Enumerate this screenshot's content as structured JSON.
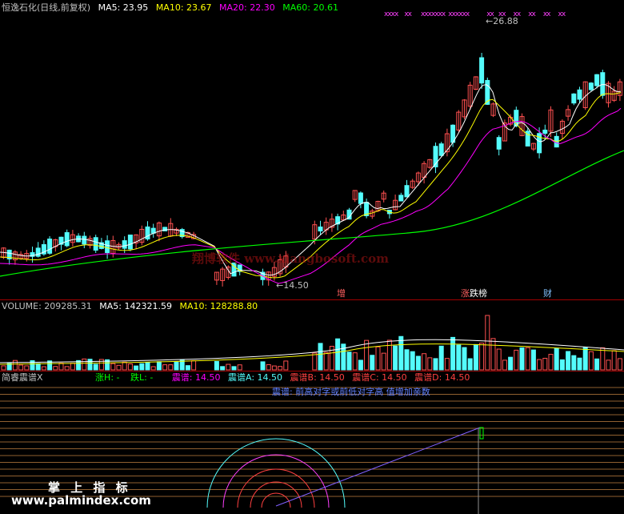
{
  "price_panel": {
    "stock_title": "恒逸石化(日线,前复权)",
    "ma5_label": "MA5: 23.95",
    "ma10_label": "MA10: 23.67",
    "ma20_label": "MA20: 22.30",
    "ma60_label": "MA60: 20.61",
    "high_label": "26.88",
    "low_label": "14.50",
    "signal_marks": [
      "xxxx",
      "xx",
      "xxxxxxx",
      "xxxxxx",
      "xx",
      "xx",
      "xx",
      "xx",
      "xx",
      "xx"
    ],
    "event_tags": [
      {
        "label": "增",
        "color": "#ff6060"
      },
      {
        "label": "涨",
        "color": "#ff6060"
      },
      {
        "label": "跌榜",
        "color": "#ffffff"
      },
      {
        "label": "财",
        "color": "#80c0ff"
      }
    ]
  },
  "volume_panel": {
    "volume_label": "VOLUME: 209285.31",
    "ma5_label": "MA5: 142321.59",
    "ma10_label": "MA10: 128288.80"
  },
  "indicator_panel": {
    "name": "简睿震谱X",
    "zh_label": "涨H: -",
    "die_label": "跌L: -",
    "zp_label": "震谱: 14.50",
    "zpa_label": "震谱A: 14.50",
    "zpb_label": "震谱B: 14.50",
    "zpc_label": "震谱C: 14.50",
    "zpd_label": "震谱D: 14.50",
    "note": "震谱: 前高对字或前低对字高 值增加亲数"
  },
  "watermarks": {
    "software": "翔博软件 www.xiangbosoft.com",
    "palm": "掌 上 指 标",
    "palm_url": "www.palmindex.com"
  },
  "colors": {
    "up": "#ff5050",
    "down": "#54fcfc",
    "ma5": "#ffffff",
    "ma10": "#ffff00",
    "ma20": "#ff00ff",
    "ma60": "#00ff00",
    "grid_line": "#c08040"
  },
  "chart_data": {
    "type": "candlestick",
    "ylim": [
      13.5,
      28
    ],
    "high": 26.88,
    "low": 14.5
  }
}
